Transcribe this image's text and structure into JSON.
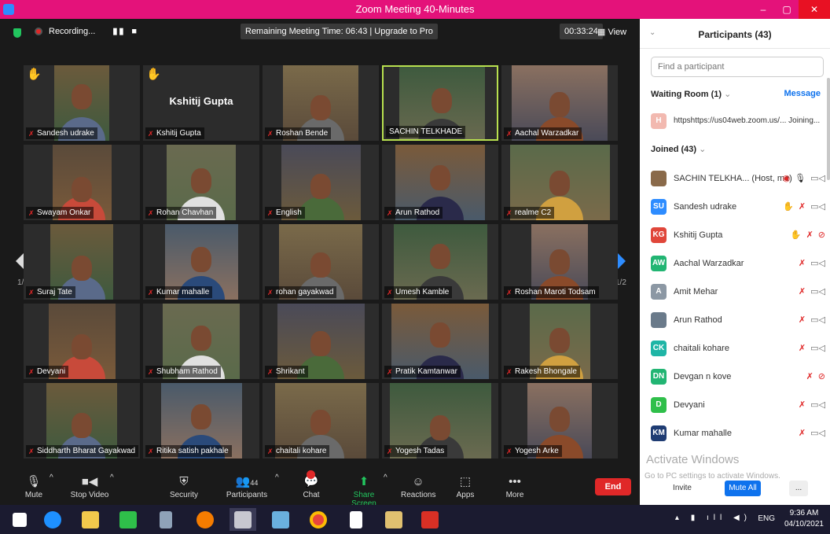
{
  "window": {
    "title": "Zoom Meeting 40-Minutes",
    "minimize": "–",
    "maximize": "▢",
    "close": "✕"
  },
  "topbar": {
    "recording": "Recording...",
    "pause": "▮▮",
    "stop": "■",
    "remaining": "Remaining Meeting Time: 06:43 | Upgrade to Pro",
    "timer": "00:33:24",
    "view": "View"
  },
  "tiles": [
    {
      "name": "Sandesh udrake",
      "hand": true
    },
    {
      "name": "Kshitij Gupta",
      "hand": true,
      "no_video": true,
      "big_name": "Kshitij Gupta"
    },
    {
      "name": "Roshan Bende"
    },
    {
      "name": "SACHIN TELKHADE",
      "active": true
    },
    {
      "name": "Aachal Warzadkar"
    },
    {
      "name": "Swayam Onkar"
    },
    {
      "name": "Rohan Chavhan"
    },
    {
      "name": "English"
    },
    {
      "name": "Arun Rathod"
    },
    {
      "name": "realme C2"
    },
    {
      "name": "Suraj Tate"
    },
    {
      "name": "Kumar mahalle"
    },
    {
      "name": "rohan gayakwad"
    },
    {
      "name": "Umesh Kamble"
    },
    {
      "name": "Roshan Maroti Todsam"
    },
    {
      "name": "Devyani"
    },
    {
      "name": "Shubham Rathod"
    },
    {
      "name": "Shrikant"
    },
    {
      "name": "Pratik Kamtanwar"
    },
    {
      "name": "Rakesh Bhongale"
    },
    {
      "name": "Siddharth Bharat Gayakwad"
    },
    {
      "name": "Ritika satish pakhale"
    },
    {
      "name": "chaitali kohare"
    },
    {
      "name": "Yogesh Tadas"
    },
    {
      "name": "Yogesh Arke"
    }
  ],
  "pager": {
    "left": "1/2",
    "right": "1/2"
  },
  "toolbar": {
    "mute": "Mute",
    "stop_video": "Stop Video",
    "security": "Security",
    "participants": "Participants",
    "participants_count": "44",
    "chat": "Chat",
    "share_screen": "Share Screen",
    "reactions": "Reactions",
    "apps": "Apps",
    "more": "More",
    "end": "End"
  },
  "panel": {
    "title": "Participants (43)",
    "search_placeholder": "Find a participant",
    "waiting_room": "Waiting Room (1)",
    "message": "Message",
    "waiting_entry": "httpshttps://us04web.zoom.us/... Joining...",
    "waiting_avatar": "H",
    "joined": "Joined (43)",
    "participants": [
      {
        "initials": "",
        "name": "SACHIN TELKHA... (Host, me)",
        "color": "#8a6a4a",
        "icons": [
          "rec",
          "mic",
          "cam"
        ]
      },
      {
        "initials": "SU",
        "name": "Sandesh udrake",
        "color": "#2d8cff",
        "icons": [
          "hand",
          "mic-off",
          "cam"
        ]
      },
      {
        "initials": "KG",
        "name": "Kshitij Gupta",
        "color": "#e0463a",
        "icons": [
          "hand",
          "mic-off",
          "cam-off"
        ]
      },
      {
        "initials": "AW",
        "name": "Aachal Warzadkar",
        "color": "#22b573",
        "icons": [
          "mic-off",
          "cam"
        ]
      },
      {
        "initials": "A",
        "name": "Amit Mehar",
        "color": "#8c98a4",
        "icons": [
          "mic-off",
          "cam"
        ]
      },
      {
        "initials": "",
        "name": "Arun Rathod",
        "color": "#6a7a8a",
        "icons": [
          "mic-off",
          "cam"
        ]
      },
      {
        "initials": "CK",
        "name": "chaitali kohare",
        "color": "#1fb5a6",
        "icons": [
          "mic-off",
          "cam"
        ]
      },
      {
        "initials": "DN",
        "name": "Devgan n kove",
        "color": "#22b573",
        "icons": [
          "mic-off",
          "cam-off"
        ]
      },
      {
        "initials": "D",
        "name": "Devyani",
        "color": "#2fbf4a",
        "icons": [
          "mic-off",
          "cam"
        ]
      },
      {
        "initials": "KM",
        "name": "Kumar mahalle",
        "color": "#1f3c73",
        "icons": [
          "mic-off",
          "cam"
        ]
      }
    ],
    "activate_title": "Activate Windows",
    "activate_sub": "Go to PC settings to activate Windows.",
    "invite": "Invite",
    "mute_all": "Mute All",
    "more": "..."
  },
  "taskbar": {
    "lang": "ENG",
    "time": "9:36 AM",
    "date": "04/10/2021"
  }
}
